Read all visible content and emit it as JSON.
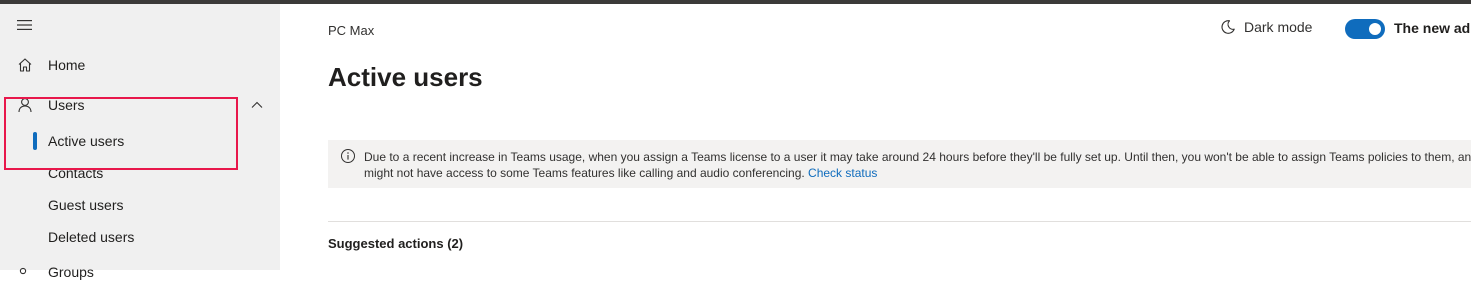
{
  "sidebar": {
    "home_label": "Home",
    "users_label": "Users",
    "sub_items": {
      "active_users": "Active users",
      "contacts": "Contacts",
      "guest_users": "Guest users",
      "deleted_users": "Deleted users"
    },
    "next_label": "Groups",
    "icons": {
      "menu": "hamburger-icon",
      "home": "home-icon",
      "users": "person-icon",
      "collapse": "chevron-up-icon"
    }
  },
  "header": {
    "org_name": "PC Max",
    "dark_mode_label": "Dark mode",
    "new_admin_label": "The new admin center",
    "toggle_on": true
  },
  "main": {
    "title": "Active users",
    "banner": {
      "line1": "Due to a recent increase in Teams usage, when you assign a Teams license to a user it may take around 24 hours before they'll be fully set up. Until then, you won't be able to assign Teams policies to them, and they",
      "line2": "might not have access to some Teams features like calling and audio conferencing.",
      "link_label": "Check status"
    },
    "suggested_actions_label": "Suggested actions (2)"
  },
  "colors": {
    "accent": "#0f6cbd",
    "highlight_box": "#e8174b",
    "sidebar_bg": "#f0f0f0",
    "banner_bg": "#f3f2f1"
  }
}
